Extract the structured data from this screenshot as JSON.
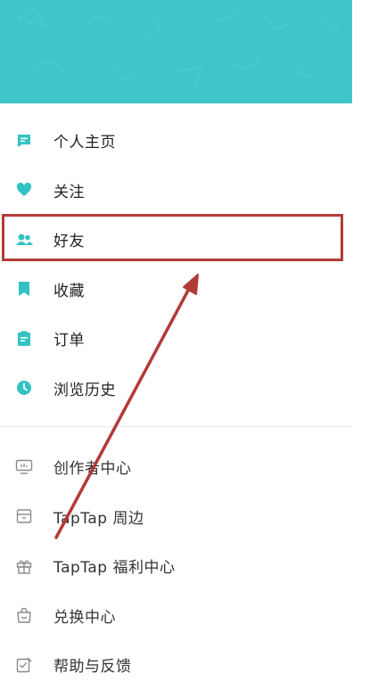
{
  "colors": {
    "header_bg": "#3ec6c9",
    "accent_icon": "#33c2c4",
    "outline_icon": "#8a8a8a",
    "annotation": "#b23b37"
  },
  "menu_primary": [
    {
      "label": "个人主页",
      "icon": "message-square-icon"
    },
    {
      "label": "关注",
      "icon": "heart-icon"
    },
    {
      "label": "好友",
      "icon": "users-icon"
    },
    {
      "label": "收藏",
      "icon": "bookmark-icon"
    },
    {
      "label": "订单",
      "icon": "clipboard-icon"
    },
    {
      "label": "浏览历史",
      "icon": "clock-icon"
    }
  ],
  "menu_secondary": [
    {
      "label": "创作者中心",
      "icon": "monitor-icon"
    },
    {
      "label": "TapTap 周边",
      "icon": "store-icon"
    },
    {
      "label": "TapTap 福利中心",
      "icon": "gift-icon"
    },
    {
      "label": "兑换中心",
      "icon": "shopping-bag-icon"
    },
    {
      "label": "帮助与反馈",
      "icon": "edit-check-icon"
    }
  ]
}
